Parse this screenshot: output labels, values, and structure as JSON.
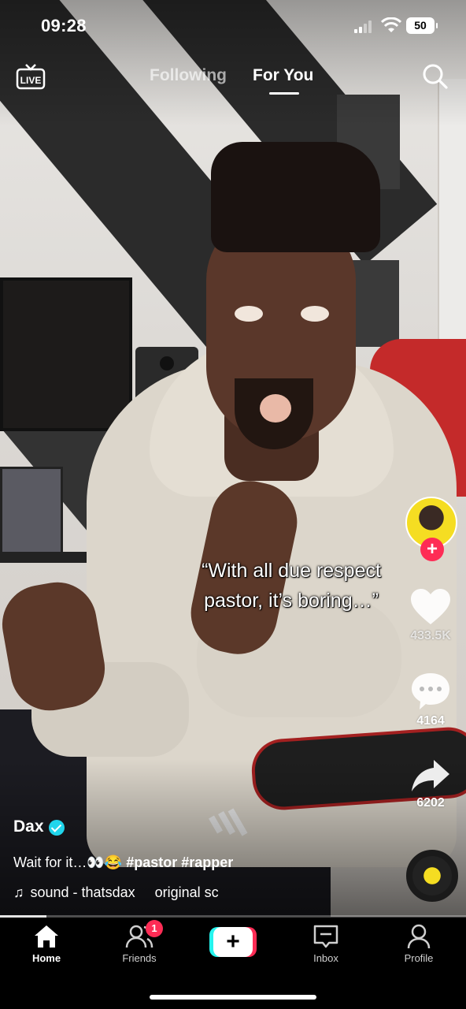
{
  "status_bar": {
    "time": "09:28",
    "battery": "50"
  },
  "top_nav": {
    "live_label": "LIVE",
    "tabs": [
      {
        "label": "Following"
      },
      {
        "label": "For You"
      }
    ]
  },
  "video": {
    "caption_line1": "“With all due respect",
    "caption_line2": "pastor, it’s boring…”",
    "progress": 0.1
  },
  "actions": {
    "likes": "433.5K",
    "comments": "4164",
    "shares": "6202"
  },
  "post": {
    "author": "Dax",
    "description_text": "Wait for it…👀😂",
    "hashtags": "#pastor #rapper",
    "sound": "sound - thatsdax     original sc"
  },
  "bottom_nav": {
    "home": "Home",
    "friends": "Friends",
    "friends_badge": "1",
    "create": "+",
    "inbox": "Inbox",
    "profile": "Profile"
  },
  "colors": {
    "accent_red": "#fe2c55",
    "accent_cyan": "#25f4ee",
    "verified_blue": "#20d5ec"
  }
}
